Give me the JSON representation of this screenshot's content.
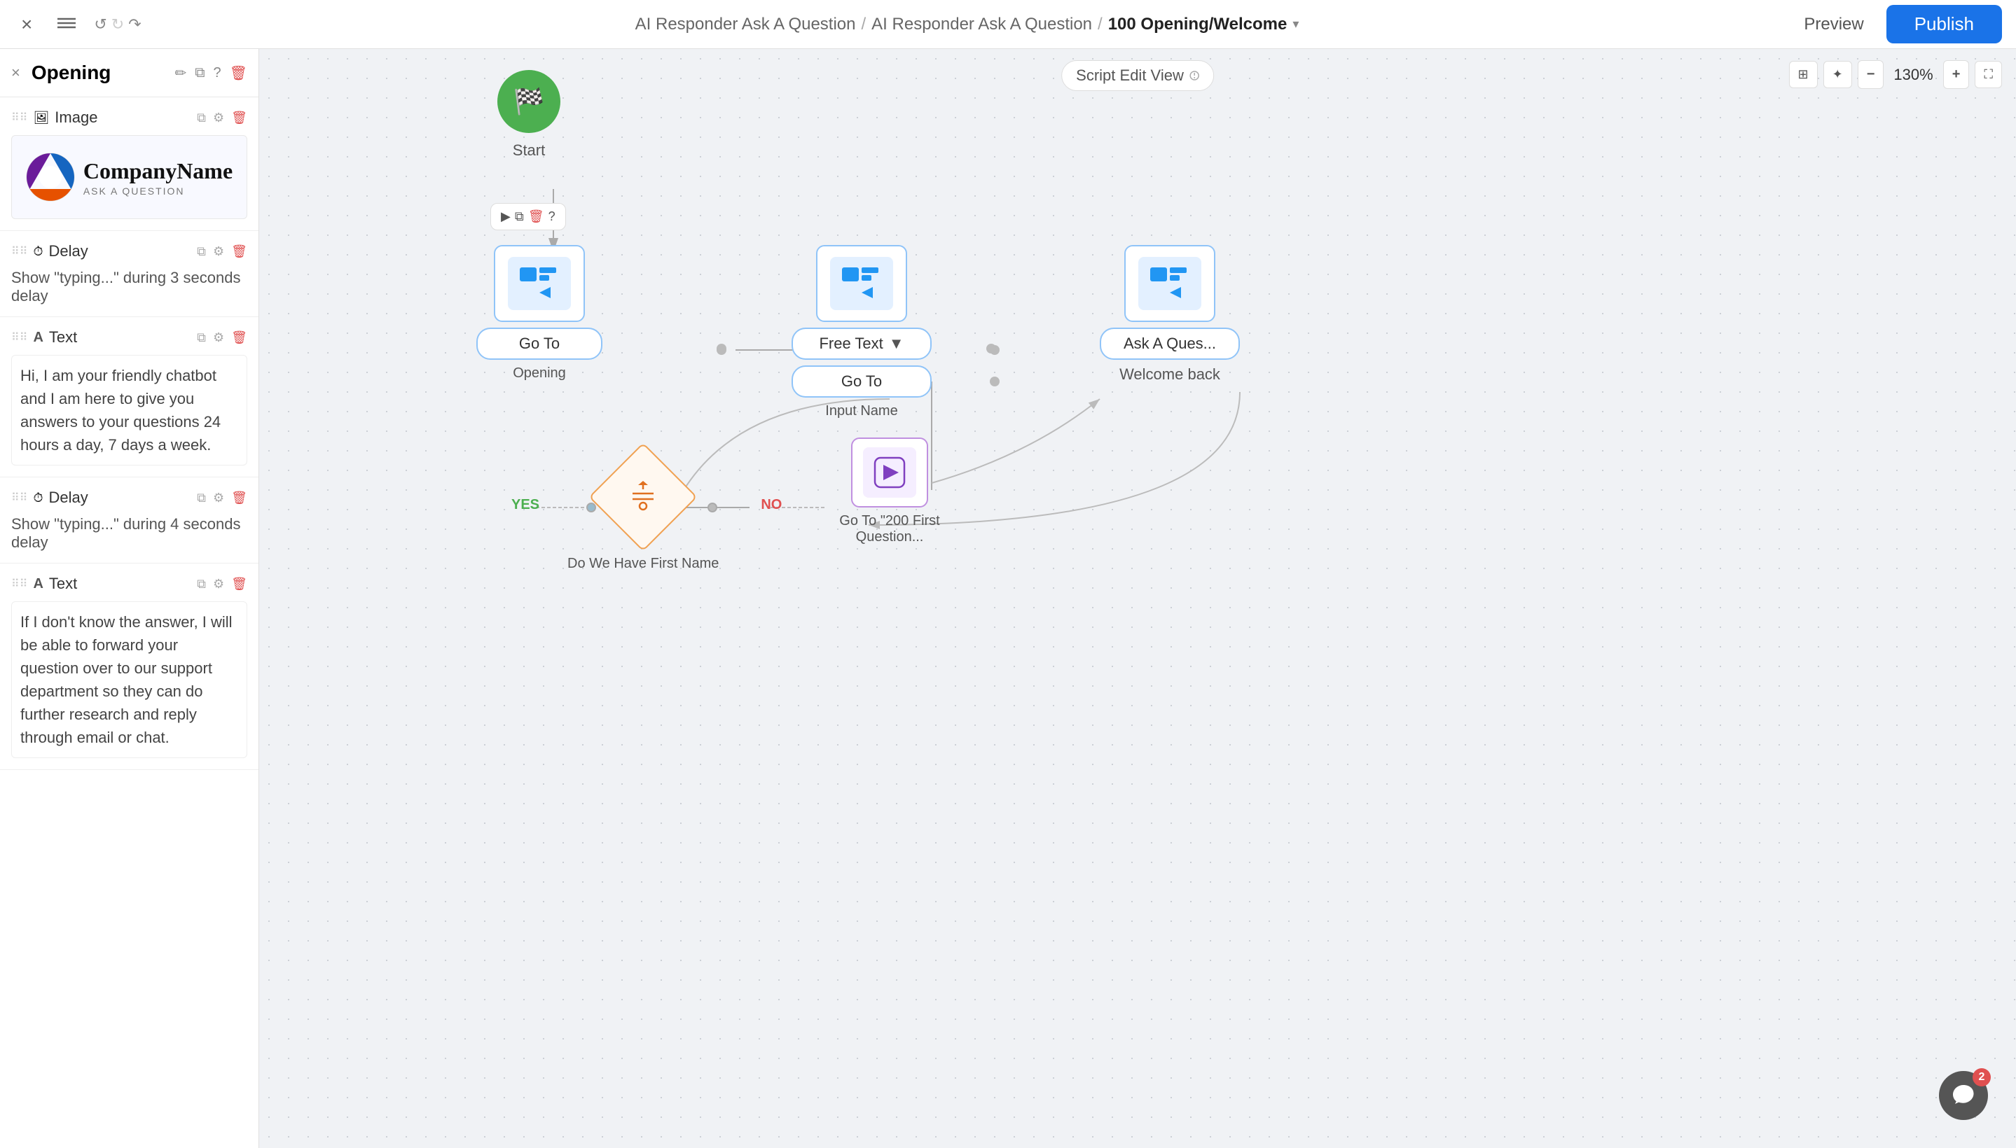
{
  "topbar": {
    "close_label": "×",
    "menu_label": "☰",
    "undo_label": "↺",
    "redo_label": "↻",
    "redo2_label": "↷",
    "breadcrumb": {
      "part1": "AI Responder Ask A Question",
      "sep1": "/",
      "part2": "AI Responder Ask A Question",
      "sep2": "/",
      "current": "100 Opening/Welcome",
      "dropdown_arrow": "▾"
    },
    "preview_label": "Preview",
    "publish_label": "Publish"
  },
  "left_panel": {
    "header": {
      "title": "Opening",
      "close_icon": "×",
      "edit_icon": "✏",
      "copy_icon": "⧉",
      "help_icon": "?",
      "del_icon": "🗑"
    },
    "sections": [
      {
        "id": "image",
        "type_label": "Image",
        "type_icon": "🖼",
        "company_name": "CompanyName",
        "company_sub": "ASK A QUESTION"
      },
      {
        "id": "delay1",
        "type_label": "Delay",
        "type_icon": "⏱",
        "content": "Show \"typing...\" during 3 seconds delay"
      },
      {
        "id": "text1",
        "type_label": "Text",
        "type_icon": "A",
        "content": "Hi, I am your friendly chatbot and I am here to give you answers to your questions 24 hours a day, 7 days a week."
      },
      {
        "id": "delay2",
        "type_label": "Delay",
        "type_icon": "⏱",
        "content": "Show \"typing...\" during 4 seconds delay"
      },
      {
        "id": "text2",
        "type_label": "Text",
        "type_icon": "A",
        "content": "If I don't know the answer, I will be able to forward your question over to our support department so they can do further research and reply through email or chat."
      }
    ]
  },
  "canvas": {
    "toolbar_label": "Script Edit View",
    "zoom_level": "130%",
    "nodes": {
      "start_label": "Start",
      "opening_goto": "Go To",
      "opening_sublabel": "Opening",
      "free_text_label": "Free Text",
      "input_name_goto": "Go To",
      "input_name_sublabel": "Input Name",
      "ask_ques_label": "Ask A Ques...",
      "welcome_back_label": "Welcome back",
      "condition_label": "Do We Have First Name",
      "yes_label": "YES",
      "no_label": "NO",
      "goto200_label": "Go To \"200 First Question..."
    }
  },
  "chat": {
    "badge": "2"
  }
}
